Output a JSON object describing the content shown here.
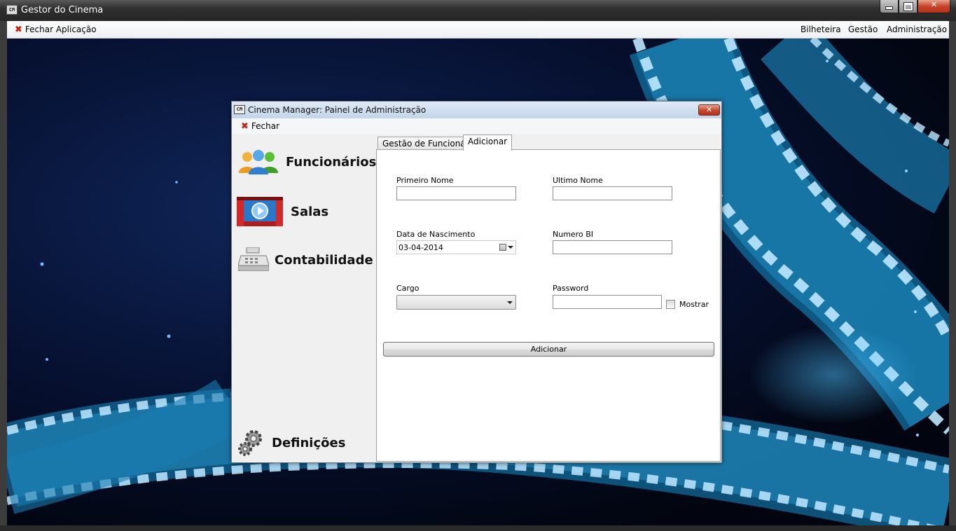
{
  "outer_window": {
    "title": "Gestor do Cinema",
    "icon_text": "CM",
    "menu": {
      "close_app": "Fechar Aplicação",
      "bilheteira": "Bilheteira",
      "gestao": "Gestão",
      "administracao": "Administração"
    }
  },
  "dialog": {
    "title": "Cinema Manager: Painel de Administração",
    "icon_text": "CM",
    "menu": {
      "close": "Fechar"
    },
    "nav": {
      "funcionarios": "Funcionários",
      "salas": "Salas",
      "contabilidade": "Contabilidade",
      "definicoes": "Definições"
    },
    "tabs": [
      {
        "label": "Gestão de Funcionários",
        "active": false
      },
      {
        "label": "Adicionar",
        "active": true
      }
    ],
    "form": {
      "first_name_label": "Primeiro Nome",
      "first_name_value": "",
      "last_name_label": "Ultimo Nome",
      "last_name_value": "",
      "birth_date_label": "Data de Nascimento",
      "birth_date_value": "03-04-2014",
      "bi_label": "Numero BI",
      "bi_value": "",
      "cargo_label": "Cargo",
      "cargo_value": "",
      "password_label": "Password",
      "password_value": "",
      "show_label": "Mostrar",
      "show_checked": false,
      "submit_label": "Adicionar"
    }
  },
  "colors": {
    "desktop_bg": "#061030",
    "film_strip": "#1f8fc4",
    "close_red": "#c5452d"
  }
}
